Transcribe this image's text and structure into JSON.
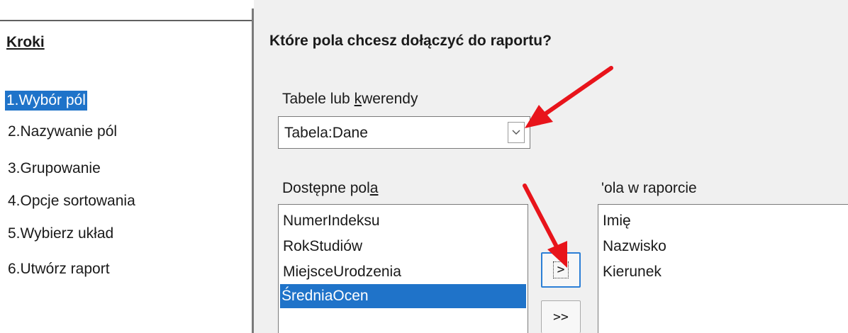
{
  "steps": {
    "title": "Kroki",
    "items": [
      {
        "label": "1.Wybór pól",
        "selected": true
      },
      {
        "label": "2.Nazywanie pól",
        "selected": false
      },
      {
        "label": "3.Grupowanie",
        "selected": false
      },
      {
        "label": "4.Opcje sortowania",
        "selected": false
      },
      {
        "label": "5.Wybierz układ",
        "selected": false
      },
      {
        "label": "6.Utwórz raport",
        "selected": false
      }
    ]
  },
  "main": {
    "question": "Które pola chcesz dołączyć do raportu?",
    "tables_label_pre": "Tabele lub ",
    "tables_label_ul": "k",
    "tables_label_post": "werendy",
    "tables_value": "Tabela:Dane",
    "available_label_pre": "Dostępne pol",
    "available_label_ul": "a",
    "available_fields": [
      {
        "label": "NumerIndeksu",
        "selected": false
      },
      {
        "label": "RokStudiów",
        "selected": false
      },
      {
        "label": "MiejsceUrodzenia",
        "selected": false
      },
      {
        "label": "ŚredniaOcen",
        "selected": true
      }
    ],
    "report_label": "'ola w raporcie",
    "report_fields": [
      "Imię",
      "Nazwisko",
      "Kierunek"
    ],
    "move_one_label": ">",
    "move_all_label": ">>"
  },
  "colors": {
    "selection": "#1f73c9",
    "annotation_arrow": "#e8141b"
  },
  "icons": {
    "dropdown": "chevron-down-icon",
    "annotation": "red-arrow-icon"
  }
}
